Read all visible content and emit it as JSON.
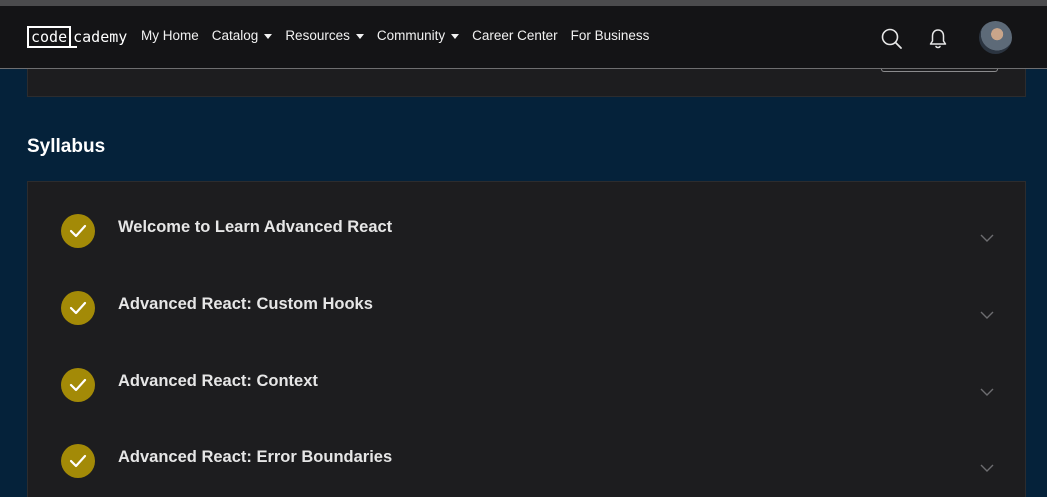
{
  "nav": {
    "logo_code": "code",
    "logo_cademy": "cademy",
    "links": [
      {
        "label": "My Home"
      },
      {
        "label": "Catalog",
        "dropdown": true
      },
      {
        "label": "Resources",
        "dropdown": true
      },
      {
        "label": "Community",
        "dropdown": true
      },
      {
        "label": "Career Center"
      },
      {
        "label": "For Business"
      }
    ],
    "icons": [
      "search-icon",
      "bell-icon",
      "avatar"
    ]
  },
  "syllabus": {
    "title": "Syllabus",
    "modules": [
      {
        "title": "Welcome to Learn Advanced React",
        "completed": true
      },
      {
        "title": "Advanced React: Custom Hooks",
        "completed": true
      },
      {
        "title": "Advanced React: Context",
        "completed": true
      },
      {
        "title": "Advanced React: Error Boundaries",
        "completed": true
      }
    ]
  },
  "colors": {
    "page_bg": "#05223a",
    "nav_bg": "#141416",
    "card_bg": "#1d1d1f",
    "check_bg": "#a38a07"
  }
}
